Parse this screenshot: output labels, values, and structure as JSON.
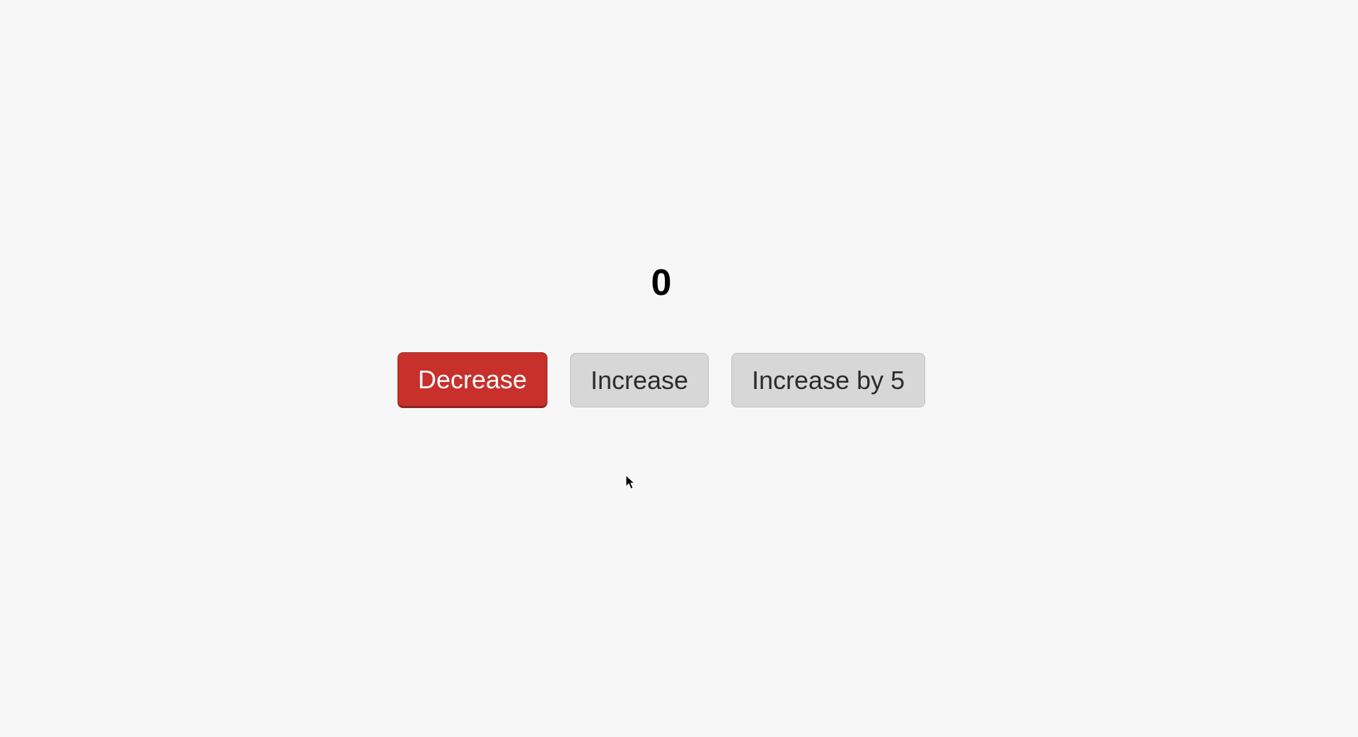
{
  "counter": {
    "value": "0"
  },
  "buttons": {
    "decrease": "Decrease",
    "increase": "Increase",
    "increase_by_5": "Increase by 5"
  }
}
